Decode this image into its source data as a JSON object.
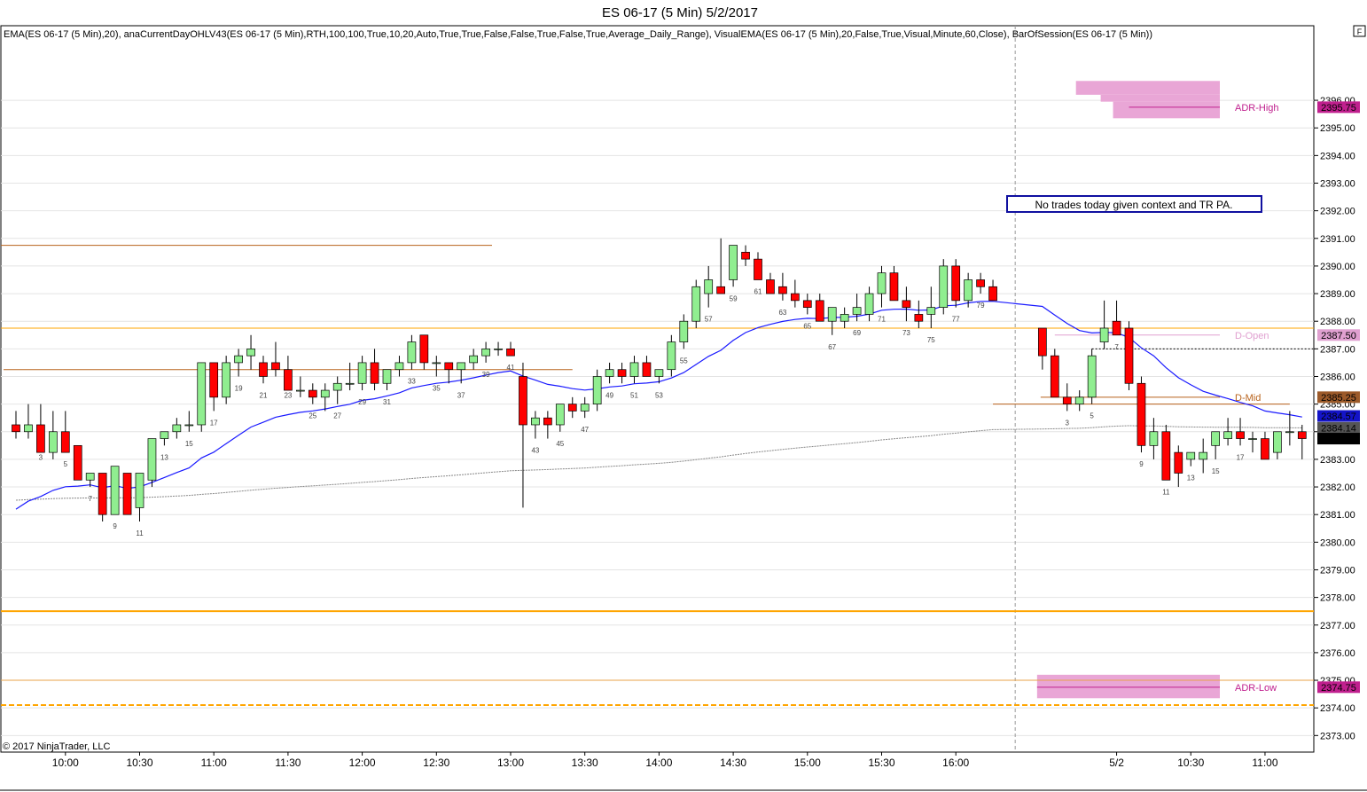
{
  "window": {
    "title": "ES 06-17 (5 Min)  5/2/2017",
    "indicator_line": "EMA(ES 06-17 (5 Min),20), anaCurrentDayOHLV43(ES 06-17 (5 Min),RTH,100,100,True,10,20,Auto,True,True,False,False,True,False,True,Average_Daily_Range), VisualEMA(ES 06-17 (5 Min),20,False,True,Visual,Minute,60,Close), BarOfSession(ES 06-17 (5 Min))",
    "corner_button": "F",
    "copyright": "© 2017 NinjaTrader, LLC"
  },
  "annotation": "No trades today given context and TR PA.",
  "colors": {
    "up": "#90EE90",
    "down": "#FF0000",
    "ema": "#1a1aff",
    "adr_fill": "#e9a6d6",
    "adr_line": "#c0208e",
    "orange": "#FFA500",
    "brown": "#b8621b"
  },
  "chart_data": {
    "type": "candlestick",
    "y_axis": {
      "min": 2372.4,
      "max": 2398.7,
      "ticks": [
        "2373.00",
        "2374.00",
        "2375.00",
        "2376.00",
        "2377.00",
        "2378.00",
        "2379.00",
        "2380.00",
        "2381.00",
        "2382.00",
        "2383.00",
        "2384.00",
        "2385.00",
        "2386.00",
        "2387.00",
        "2388.00",
        "2389.00",
        "2390.00",
        "2391.00",
        "2392.00",
        "2393.00",
        "2394.00",
        "2395.00",
        "2396.00"
      ]
    },
    "x_axis": {
      "labels": [
        "10:00",
        "10:30",
        "11:00",
        "11:30",
        "12:00",
        "12:30",
        "13:00",
        "13:30",
        "14:00",
        "14:30",
        "15:00",
        "15:30",
        "16:00",
        "5/2",
        "10:30",
        "11:00"
      ]
    },
    "session_break_after_bar": 81,
    "session1": [
      [
        2384.25,
        2384.75,
        2383.75,
        2384.0
      ],
      [
        2384.0,
        2385.0,
        2383.75,
        2384.25
      ],
      [
        2384.25,
        2385.0,
        2383.5,
        2383.25
      ],
      [
        2383.25,
        2384.75,
        2383.0,
        2384.0
      ],
      [
        2384.0,
        2384.75,
        2383.25,
        2383.25
      ],
      [
        2383.5,
        2383.5,
        2382.25,
        2382.25
      ],
      [
        2382.25,
        2382.5,
        2382.0,
        2382.5
      ],
      [
        2382.5,
        2382.5,
        2380.75,
        2381.0
      ],
      [
        2381.0,
        2382.75,
        2381.0,
        2382.75
      ],
      [
        2382.5,
        2382.5,
        2381.0,
        2381.0
      ],
      [
        2381.25,
        2382.5,
        2380.75,
        2382.5
      ],
      [
        2382.25,
        2383.75,
        2382.0,
        2383.75
      ],
      [
        2383.75,
        2384.0,
        2383.5,
        2384.0
      ],
      [
        2384.0,
        2384.5,
        2383.75,
        2384.25
      ],
      [
        2384.25,
        2384.75,
        2384.0,
        2384.25
      ],
      [
        2384.25,
        2386.5,
        2384.0,
        2386.5
      ],
      [
        2386.5,
        2386.5,
        2384.75,
        2385.25
      ],
      [
        2385.25,
        2386.75,
        2385.0,
        2386.5
      ],
      [
        2386.5,
        2387.0,
        2386.0,
        2386.75
      ],
      [
        2386.75,
        2387.5,
        2386.25,
        2387.0
      ],
      [
        2386.5,
        2386.75,
        2385.75,
        2386.0
      ],
      [
        2386.5,
        2387.25,
        2386.0,
        2386.25
      ],
      [
        2386.25,
        2386.75,
        2385.75,
        2385.5
      ],
      [
        2385.5,
        2386.0,
        2385.25,
        2385.5
      ],
      [
        2385.5,
        2385.75,
        2385.0,
        2385.25
      ],
      [
        2385.25,
        2385.75,
        2384.75,
        2385.5
      ],
      [
        2385.5,
        2386.0,
        2385.0,
        2385.75
      ],
      [
        2385.75,
        2386.5,
        2385.5,
        2385.75
      ],
      [
        2385.75,
        2386.75,
        2385.5,
        2386.5
      ],
      [
        2386.5,
        2387.0,
        2385.5,
        2385.75
      ],
      [
        2385.75,
        2386.25,
        2385.5,
        2386.25
      ],
      [
        2386.25,
        2386.75,
        2386.0,
        2386.5
      ],
      [
        2386.5,
        2387.5,
        2386.25,
        2387.25
      ],
      [
        2387.5,
        2387.5,
        2386.25,
        2386.5
      ],
      [
        2386.5,
        2386.75,
        2386.0,
        2386.5
      ],
      [
        2386.5,
        2386.5,
        2385.75,
        2386.25
      ],
      [
        2386.25,
        2386.5,
        2385.75,
        2386.5
      ],
      [
        2386.5,
        2387.0,
        2386.25,
        2386.75
      ],
      [
        2386.75,
        2387.25,
        2386.5,
        2387.0
      ],
      [
        2387.0,
        2387.25,
        2386.75,
        2387.0
      ],
      [
        2387.0,
        2387.25,
        2386.75,
        2386.75
      ],
      [
        2386.0,
        2386.5,
        2381.25,
        2384.25
      ],
      [
        2384.25,
        2384.75,
        2383.75,
        2384.5
      ],
      [
        2384.5,
        2384.75,
        2383.75,
        2384.25
      ],
      [
        2384.25,
        2385.0,
        2384.0,
        2385.0
      ],
      [
        2385.0,
        2385.25,
        2384.5,
        2384.75
      ],
      [
        2384.75,
        2385.25,
        2384.5,
        2385.0
      ],
      [
        2385.0,
        2386.25,
        2384.75,
        2386.0
      ],
      [
        2386.0,
        2386.5,
        2385.75,
        2386.25
      ],
      [
        2386.25,
        2386.5,
        2385.75,
        2386.0
      ],
      [
        2386.0,
        2386.75,
        2385.75,
        2386.5
      ],
      [
        2386.5,
        2386.75,
        2386.0,
        2386.0
      ],
      [
        2386.0,
        2386.25,
        2385.75,
        2386.25
      ],
      [
        2386.25,
        2387.5,
        2386.0,
        2387.25
      ],
      [
        2387.25,
        2388.25,
        2387.0,
        2388.0
      ],
      [
        2388.0,
        2389.5,
        2387.75,
        2389.25
      ],
      [
        2389.0,
        2390.0,
        2388.5,
        2389.5
      ],
      [
        2389.25,
        2391.0,
        2389.0,
        2389.0
      ],
      [
        2389.5,
        2390.75,
        2389.25,
        2390.75
      ],
      [
        2390.5,
        2390.75,
        2390.0,
        2390.25
      ],
      [
        2390.25,
        2390.5,
        2389.5,
        2389.5
      ],
      [
        2389.5,
        2389.75,
        2389.0,
        2389.0
      ],
      [
        2389.25,
        2389.75,
        2388.75,
        2389.0
      ],
      [
        2389.0,
        2389.5,
        2388.5,
        2388.75
      ],
      [
        2388.75,
        2389.0,
        2388.25,
        2388.5
      ],
      [
        2388.75,
        2389.0,
        2388.25,
        2388.0
      ],
      [
        2388.0,
        2388.5,
        2387.5,
        2388.5
      ],
      [
        2388.0,
        2388.5,
        2387.75,
        2388.25
      ],
      [
        2388.25,
        2389.0,
        2388.0,
        2388.5
      ],
      [
        2388.25,
        2389.25,
        2388.0,
        2389.0
      ],
      [
        2389.0,
        2390.0,
        2388.5,
        2389.75
      ],
      [
        2389.75,
        2390.0,
        2389.25,
        2388.75
      ],
      [
        2388.75,
        2389.25,
        2388.0,
        2388.5
      ],
      [
        2388.25,
        2388.75,
        2387.75,
        2388.0
      ],
      [
        2388.25,
        2389.25,
        2387.75,
        2388.5
      ],
      [
        2388.5,
        2390.25,
        2388.25,
        2390.0
      ],
      [
        2390.0,
        2390.25,
        2388.5,
        2388.75
      ],
      [
        2388.75,
        2389.75,
        2388.5,
        2389.5
      ],
      [
        2389.5,
        2389.75,
        2389.0,
        2389.25
      ],
      [
        2389.25,
        2389.5,
        2388.75,
        2388.75
      ]
    ],
    "session2": [
      [
        2387.75,
        2387.75,
        2386.25,
        2386.75
      ],
      [
        2386.75,
        2387.0,
        2386.0,
        2385.25
      ],
      [
        2385.25,
        2385.75,
        2384.75,
        2385.0
      ],
      [
        2385.0,
        2385.5,
        2384.75,
        2385.25
      ],
      [
        2385.25,
        2387.0,
        2385.0,
        2386.75
      ],
      [
        2387.25,
        2388.75,
        2387.0,
        2387.75
      ],
      [
        2388.0,
        2388.75,
        2387.5,
        2387.5
      ],
      [
        2387.75,
        2388.0,
        2385.5,
        2385.75
      ],
      [
        2385.75,
        2386.0,
        2383.25,
        2383.5
      ],
      [
        2383.5,
        2384.5,
        2383.0,
        2384.0
      ],
      [
        2384.0,
        2384.25,
        2382.25,
        2382.25
      ],
      [
        2383.25,
        2383.5,
        2382.0,
        2382.5
      ],
      [
        2383.0,
        2383.25,
        2382.75,
        2383.25
      ],
      [
        2383.0,
        2383.75,
        2382.5,
        2383.25
      ],
      [
        2383.5,
        2384.0,
        2383.0,
        2384.0
      ],
      [
        2383.75,
        2384.5,
        2383.5,
        2384.0
      ],
      [
        2384.0,
        2384.5,
        2383.5,
        2383.75
      ],
      [
        2383.75,
        2384.0,
        2383.25,
        2383.75
      ],
      [
        2383.75,
        2384.0,
        2383.0,
        2383.0
      ],
      [
        2383.25,
        2384.0,
        2383.0,
        2384.0
      ],
      [
        2384.0,
        2384.75,
        2383.5,
        2384.0
      ],
      [
        2384.0,
        2384.25,
        2383.0,
        2383.75
      ]
    ],
    "bar_number_labels": [
      {
        "session": 1,
        "bar": 3,
        "label": "3"
      },
      {
        "session": 1,
        "bar": 5,
        "label": "5"
      },
      {
        "session": 1,
        "bar": 7,
        "label": "7"
      },
      {
        "session": 1,
        "bar": 9,
        "label": "9"
      },
      {
        "session": 1,
        "bar": 11,
        "label": "11"
      },
      {
        "session": 1,
        "bar": 13,
        "label": "13"
      },
      {
        "session": 1,
        "bar": 15,
        "label": "15"
      },
      {
        "session": 1,
        "bar": 17,
        "label": "17"
      },
      {
        "session": 1,
        "bar": 19,
        "label": "19"
      },
      {
        "session": 1,
        "bar": 21,
        "label": "21"
      },
      {
        "session": 1,
        "bar": 23,
        "label": "23"
      },
      {
        "session": 1,
        "bar": 25,
        "label": "25"
      },
      {
        "session": 1,
        "bar": 27,
        "label": "27"
      },
      {
        "session": 1,
        "bar": 29,
        "label": "29"
      },
      {
        "session": 1,
        "bar": 31,
        "label": "31"
      },
      {
        "session": 1,
        "bar": 33,
        "label": "33"
      },
      {
        "session": 1,
        "bar": 35,
        "label": "35"
      },
      {
        "session": 1,
        "bar": 37,
        "label": "37"
      },
      {
        "session": 1,
        "bar": 39,
        "label": "39"
      },
      {
        "session": 1,
        "bar": 41,
        "label": "41"
      },
      {
        "session": 1,
        "bar": 43,
        "label": "43"
      },
      {
        "session": 1,
        "bar": 45,
        "label": "45"
      },
      {
        "session": 1,
        "bar": 47,
        "label": "47"
      },
      {
        "session": 1,
        "bar": 49,
        "label": "49"
      },
      {
        "session": 1,
        "bar": 51,
        "label": "51"
      },
      {
        "session": 1,
        "bar": 53,
        "label": "53"
      },
      {
        "session": 1,
        "bar": 55,
        "label": "55"
      },
      {
        "session": 1,
        "bar": 57,
        "label": "57"
      },
      {
        "session": 1,
        "bar": 59,
        "label": "59"
      },
      {
        "session": 1,
        "bar": 61,
        "label": "61"
      },
      {
        "session": 1,
        "bar": 63,
        "label": "63"
      },
      {
        "session": 1,
        "bar": 65,
        "label": "65"
      },
      {
        "session": 1,
        "bar": 67,
        "label": "67"
      },
      {
        "session": 1,
        "bar": 69,
        "label": "69"
      },
      {
        "session": 1,
        "bar": 71,
        "label": "71"
      },
      {
        "session": 1,
        "bar": 73,
        "label": "73"
      },
      {
        "session": 1,
        "bar": 75,
        "label": "75"
      },
      {
        "session": 1,
        "bar": 77,
        "label": "77"
      },
      {
        "session": 1,
        "bar": 79,
        "label": "79"
      },
      {
        "session": 1,
        "bar": 81,
        "label": "81"
      },
      {
        "session": 2,
        "bar": 3,
        "label": "3"
      },
      {
        "session": 2,
        "bar": 5,
        "label": "5"
      },
      {
        "session": 2,
        "bar": 7,
        "label": "7"
      },
      {
        "session": 2,
        "bar": 9,
        "label": "9"
      },
      {
        "session": 2,
        "bar": 11,
        "label": "11"
      },
      {
        "session": 2,
        "bar": 13,
        "label": "13"
      },
      {
        "session": 2,
        "bar": 15,
        "label": "15"
      },
      {
        "session": 2,
        "bar": 17,
        "label": "17"
      }
    ],
    "levels": [
      {
        "name": "D-Open",
        "value": 2387.5,
        "label": "D-Open",
        "price_label": "2387.50",
        "color": "#e0a0d0",
        "box": "#e0a0d0"
      },
      {
        "name": "D-Mid",
        "value": 2385.25,
        "label": "D-Mid",
        "price_label": "2385.25",
        "color": "#b8621b",
        "box": "#9c5a2a"
      },
      {
        "name": "ADR-High",
        "value": 2395.75,
        "label": "ADR-High",
        "price_label": "2395.75",
        "color": "#c0208e",
        "box": "#c0208e"
      },
      {
        "name": "ADR-Low",
        "value": 2374.75,
        "label": "ADR-Low",
        "price_label": "2374.75",
        "color": "#c0208e",
        "box": "#c0208e"
      }
    ],
    "price_tags": [
      {
        "value": 2384.57,
        "label": "2384.57",
        "box": "#1414c8"
      },
      {
        "value": 2384.14,
        "label": "2384.14",
        "box": "#555555"
      },
      {
        "value": 2383.75,
        "label": "2383.75",
        "box": "#000000"
      }
    ],
    "horizontal_lines": [
      {
        "value": 2390.75,
        "kind": "prior-high",
        "color": "#b8621b"
      },
      {
        "value": 2387.75,
        "kind": "orange-level",
        "color": "#FFA500"
      },
      {
        "value": 2386.25,
        "kind": "brown-level",
        "color": "#b8621b"
      },
      {
        "value": 2377.5,
        "kind": "orange-thick",
        "color": "#FFA500"
      },
      {
        "value": 2375.0,
        "kind": "orange-thin",
        "color": "#e8a34a"
      },
      {
        "value": 2374.1,
        "kind": "orange-dashed",
        "color": "#FFA500"
      },
      {
        "value": 2387.0,
        "kind": "dotted-black",
        "color": "#000000"
      }
    ]
  }
}
